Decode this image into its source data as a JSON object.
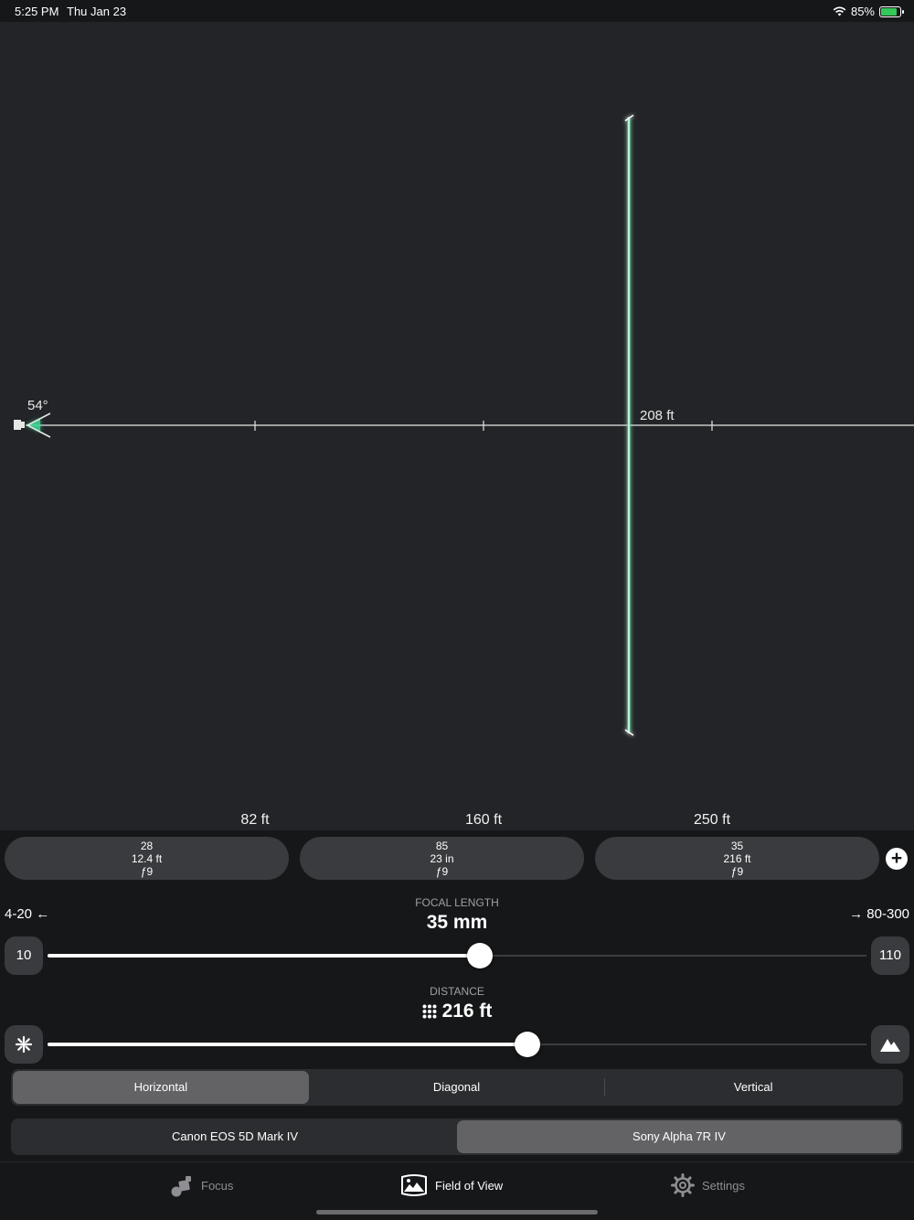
{
  "status_bar": {
    "time": "5:25 PM",
    "date": "Thu Jan 23",
    "battery_percent": "85%",
    "battery_level": 0.85,
    "icons": [
      "wifi-icon",
      "battery-charging-icon"
    ]
  },
  "viewer": {
    "angle": "54°",
    "target_distance": "208 ft",
    "distance_marks": [
      "82 ft",
      "160 ft",
      "250 ft"
    ],
    "accent_color": "#3ddc97"
  },
  "presets": [
    {
      "focal": "28",
      "distance": "12.4 ft",
      "aperture": "ƒ9"
    },
    {
      "focal": "85",
      "distance": "23 in",
      "aperture": "ƒ9"
    },
    {
      "focal": "35",
      "distance": "216 ft",
      "aperture": "ƒ9"
    }
  ],
  "focal_length": {
    "label": "FOCAL LENGTH",
    "value": "35 mm",
    "prev_range": "4-20 ←",
    "next_range": "→ 80-300",
    "min": "10",
    "max": "110",
    "level": 0.528
  },
  "distance": {
    "label": "DISTANCE",
    "value": "216 ft",
    "level": 0.586,
    "left_icon": "flower-macro-icon",
    "right_icon": "mountain-icon"
  },
  "orientation": {
    "options": [
      "Horizontal",
      "Diagonal",
      "Vertical"
    ],
    "selected": "Horizontal"
  },
  "cameras": {
    "options": [
      "Canon EOS 5D Mark IV",
      "Sony Alpha 7R IV"
    ],
    "selected": "Sony Alpha 7R IV"
  },
  "tabs": [
    {
      "label": "Focus",
      "icon": "focus-icon"
    },
    {
      "label": "Field of View",
      "icon": "field-of-view-icon"
    },
    {
      "label": "Settings",
      "icon": "gear-icon"
    }
  ],
  "active_tab": "Field of View"
}
